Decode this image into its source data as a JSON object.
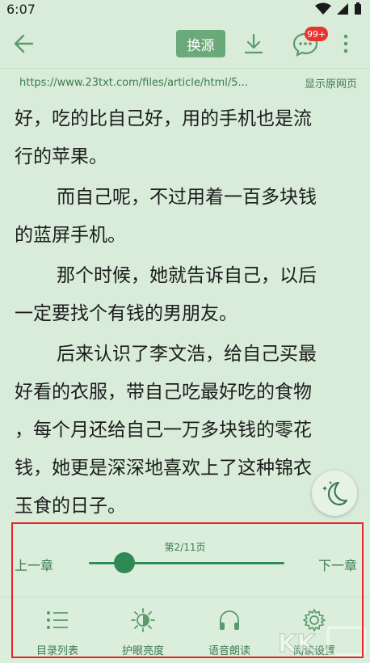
{
  "status_bar": {
    "time": "6:07"
  },
  "toolbar": {
    "switch_source_label": "换源",
    "comment_badge": "99+"
  },
  "url_bar": {
    "url": "https://www.23txt.com/files/article/html/5...",
    "show_original_label": "显示原网页"
  },
  "content": {
    "paragraphs": [
      {
        "lines": [
          "好，吃的比自己好，用的手机也是流",
          "行的苹果。"
        ]
      },
      {
        "lines": [
          "而自己呢，不过用着一百多块钱",
          "的蓝屏手机。"
        ]
      },
      {
        "lines": [
          "那个时候，她就告诉自己，以后",
          "一定要找个有钱的男朋友。"
        ]
      },
      {
        "lines": [
          "后来认识了李文浩，给自己买最",
          "好看的衣服，带自己吃最好吃的食物",
          "，每个月还给自己一万多块钱的零花",
          "钱，她更是深深地喜欢上了这种锦衣",
          "玉食的日子。"
        ]
      }
    ]
  },
  "reader_panel": {
    "page_indicator": "第2/11页",
    "prev_chapter_label": "上一章",
    "next_chapter_label": "下一章",
    "progress_fraction": 0.182,
    "menu": [
      {
        "label": "目录列表",
        "icon": "list-icon"
      },
      {
        "label": "护眼亮度",
        "icon": "brightness-icon"
      },
      {
        "label": "语音朗读",
        "icon": "headphones-icon"
      },
      {
        "label": "阅读设置",
        "icon": "settings-gear-icon"
      }
    ]
  },
  "colors": {
    "background": "#d8ecd9",
    "accent": "#2e8a55",
    "accent_text": "#3d7a4f",
    "button": "#6aa97a",
    "badge": "#e8342c",
    "highlight": "#e3262b"
  }
}
